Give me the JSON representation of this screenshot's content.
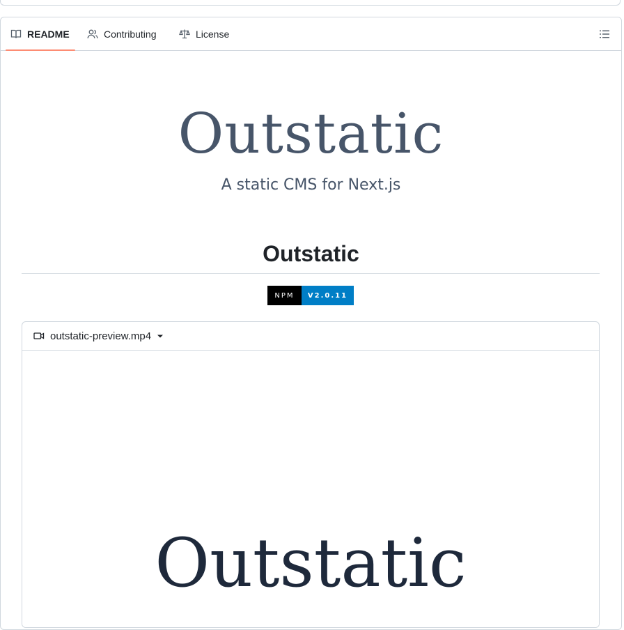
{
  "tabs": {
    "readme": "README",
    "contributing": "Contributing",
    "license": "License"
  },
  "logo": {
    "title": "Outstatic",
    "subtitle": "A static CMS for Next.js"
  },
  "heading": "Outstatic",
  "badge": {
    "left": "NPM",
    "right": "V2.0.11"
  },
  "video": {
    "filename": "outstatic-preview.mp4",
    "frame_text": "Outstatic"
  },
  "colors": {
    "tab_underline": "#fd8c73",
    "badge_version": "#007ec6",
    "logo_text": "#475569"
  },
  "icons": [
    "book-icon",
    "people-icon",
    "law-icon",
    "list-unordered-icon",
    "device-camera-video-icon",
    "triangle-down-icon"
  ]
}
